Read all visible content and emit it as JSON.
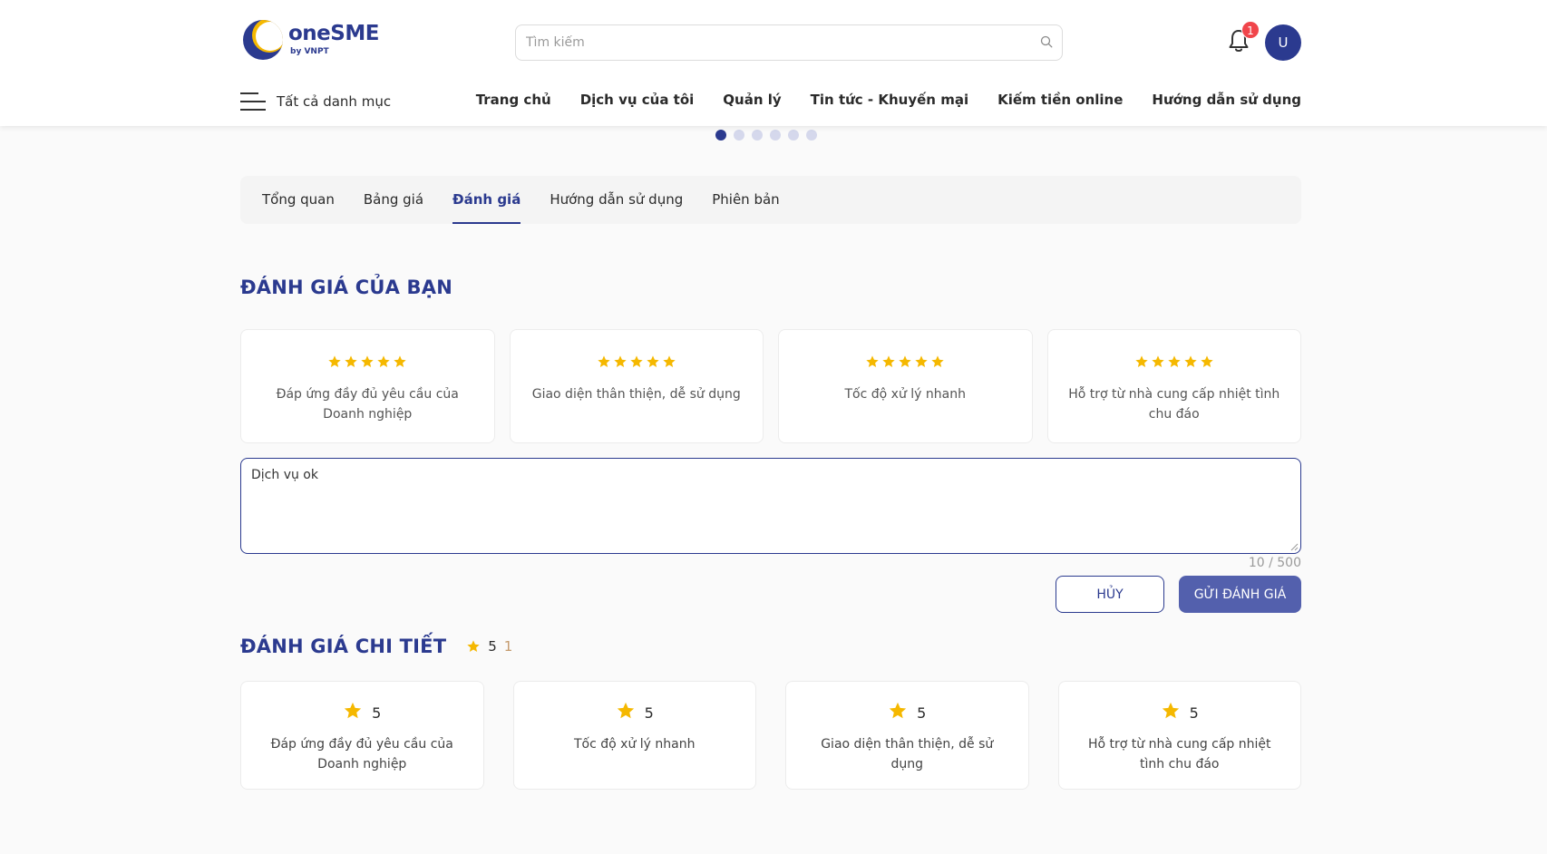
{
  "brand": {
    "name": "oneSME",
    "sub": "by VNPT",
    "primary": "#2b3a8f",
    "accent": "#f5b800"
  },
  "header": {
    "search_placeholder": "Tìm kiếm",
    "notification_count": "1",
    "avatar_initial": "U",
    "menu_label": "Tất cả danh mục",
    "nav": [
      "Trang chủ",
      "Dịch vụ của tôi",
      "Quản lý",
      "Tin tức - Khuyến mại",
      "Kiếm tiền online",
      "Hướng dẫn sử dụng"
    ]
  },
  "carousel": {
    "count": 6,
    "active": 0
  },
  "tabs": [
    "Tổng quan",
    "Bảng giá",
    "Đánh giá",
    "Hướng dẫn sử dụng",
    "Phiên bản"
  ],
  "active_tab": 2,
  "your_review": {
    "title": "ĐÁNH GIÁ CỦA BẠN",
    "criteria": [
      {
        "label": "Đáp ứng đầy đủ yêu cầu của Doanh nghiệp",
        "stars": 5
      },
      {
        "label": "Giao diện thân thiện, dễ sử dụng",
        "stars": 5
      },
      {
        "label": "Tốc độ xử lý nhanh",
        "stars": 5
      },
      {
        "label": "Hỗ trợ từ nhà cung cấp nhiệt tình chu đáo",
        "stars": 5
      }
    ],
    "comment": "Dịch vụ ok",
    "counter": "10 / 500",
    "cancel_label": "HỦY",
    "submit_label": "GỬI ĐÁNH GIÁ"
  },
  "detail": {
    "title": "ĐÁNH GIÁ CHI TIẾT",
    "average": "5",
    "count": "1",
    "items": [
      {
        "label": "Đáp ứng đầy đủ yêu cầu của Doanh nghiệp",
        "score": "5"
      },
      {
        "label": "Tốc độ xử lý nhanh",
        "score": "5"
      },
      {
        "label": "Giao diện thân thiện, dễ sử dụng",
        "score": "5"
      },
      {
        "label": "Hỗ trợ từ nhà cung cấp nhiệt tình chu đáo",
        "score": "5"
      }
    ]
  },
  "icons": {
    "search": "search-icon",
    "bell": "bell-icon",
    "star": "star-icon",
    "menu": "hamburger-menu-icon"
  }
}
